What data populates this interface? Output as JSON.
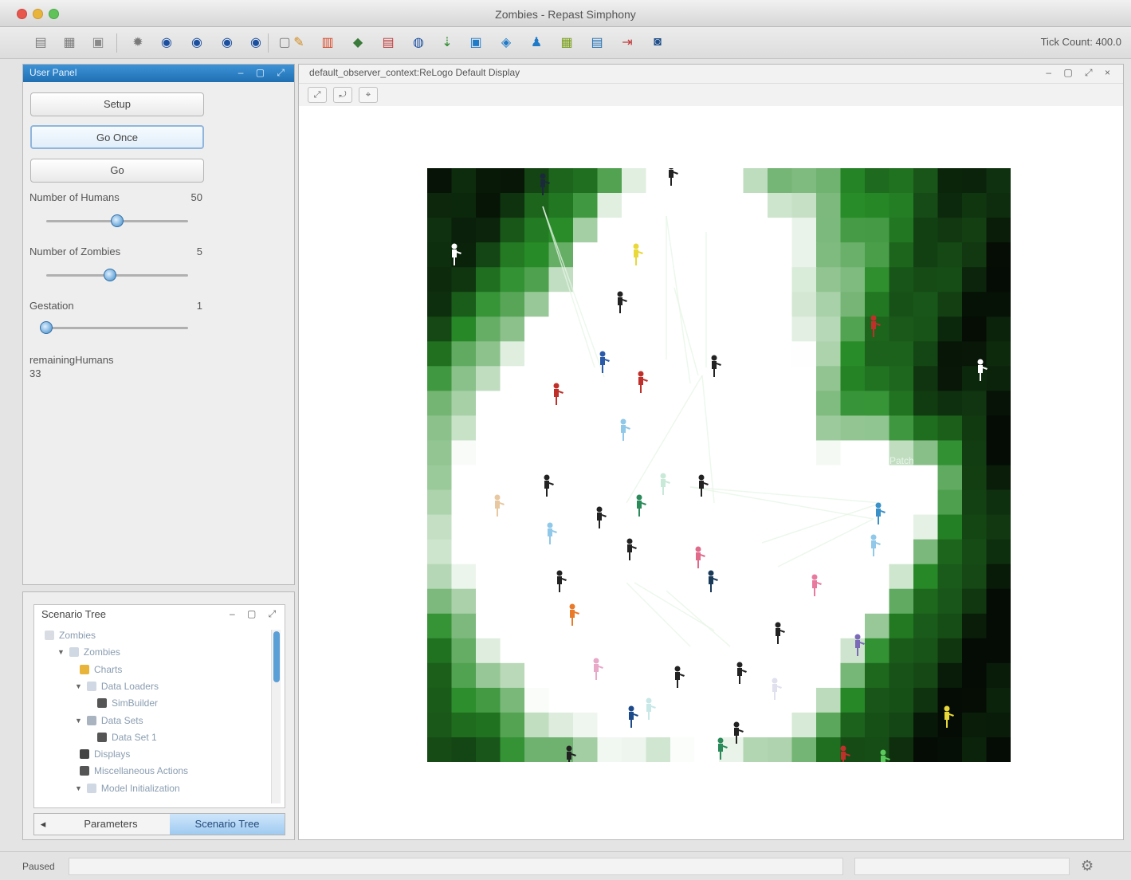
{
  "window": {
    "title": "Zombies - Repast Simphony"
  },
  "toolbar": {
    "tick_count": "Tick Count: 400.0",
    "buttons": [
      {
        "icon": "save-icon",
        "glyph": "▤",
        "color": "#7a7a7a"
      },
      {
        "icon": "floppy-icon",
        "glyph": "▦",
        "color": "#7a7a7a"
      },
      {
        "icon": "print-icon",
        "glyph": "▣",
        "color": "#8a8a8a"
      },
      {
        "icon": "settings-icon",
        "glyph": "✹",
        "color": "#7a7a7a"
      },
      {
        "icon": "step-icon",
        "glyph": "◉",
        "color": "#1b4fa0"
      },
      {
        "icon": "play-icon",
        "glyph": "◉",
        "color": "#1b4fa0"
      },
      {
        "icon": "stop-icon",
        "glyph": "◉",
        "color": "#1b4fa0"
      },
      {
        "icon": "reset-icon",
        "glyph": "◉",
        "color": "#1b4fa0"
      },
      {
        "icon": "window-icon",
        "glyph": "▢",
        "color": "#7a7a7a"
      },
      {
        "icon": "wand-icon",
        "glyph": "✎",
        "color": "#d08a1a"
      },
      {
        "icon": "chart-icon",
        "glyph": "▥",
        "color": "#d84a2a"
      },
      {
        "icon": "cube-icon",
        "glyph": "◆",
        "color": "#3a7a3a"
      },
      {
        "icon": "database-icon",
        "glyph": "▤",
        "color": "#c03a3a"
      },
      {
        "icon": "globe-icon",
        "glyph": "◍",
        "color": "#1b4fa0"
      },
      {
        "icon": "arrow-icon",
        "glyph": "⇣",
        "color": "#2a8a2a"
      },
      {
        "icon": "monitor-icon",
        "glyph": "▣",
        "color": "#1f7ac8"
      },
      {
        "icon": "network-icon",
        "glyph": "◈",
        "color": "#1f7ac8"
      },
      {
        "icon": "people-icon",
        "glyph": "♟",
        "color": "#1f7ac8"
      },
      {
        "icon": "spreadsheet-icon",
        "glyph": "▦",
        "color": "#7aa01a"
      },
      {
        "icon": "document-icon",
        "glyph": "▤",
        "color": "#1f6fb3"
      },
      {
        "icon": "export-icon",
        "glyph": "⇥",
        "color": "#c03a3a"
      },
      {
        "icon": "camera-icon",
        "glyph": "◙",
        "color": "#1f4f8a"
      }
    ]
  },
  "user_panel": {
    "title": "User Panel",
    "setup_label": "Setup",
    "go_once_label": "Go Once",
    "go_label": "Go",
    "params": [
      {
        "label": "Number of Humans",
        "value": "50",
        "level": 0.5
      },
      {
        "label": "Number of Zombies",
        "value": "5",
        "level": 0.45
      },
      {
        "label": "Gestation",
        "value": "1",
        "level": 0.0
      }
    ],
    "remaining_label": "remainingHumans",
    "remaining_value": "33"
  },
  "scenario": {
    "title": "Scenario Tree",
    "items": [
      {
        "label": "Zombies",
        "indent": 0,
        "tri": "",
        "color": "#d9dde3"
      },
      {
        "label": "Zombies",
        "indent": 1,
        "tri": "▼",
        "color": "#cfd8e3"
      },
      {
        "label": "Charts",
        "indent": 2,
        "tri": "",
        "color": "#e8b53a"
      },
      {
        "label": "Data Loaders",
        "indent": 2,
        "tri": "▼",
        "color": "#cfd8e3"
      },
      {
        "label": "SimBuilder",
        "indent": 3,
        "tri": "",
        "color": "#555555"
      },
      {
        "label": "Data Sets",
        "indent": 2,
        "tri": "▼",
        "color": "#a9b4c0"
      },
      {
        "label": "Data Set 1",
        "indent": 3,
        "tri": "",
        "color": "#555555"
      },
      {
        "label": "Displays",
        "indent": 2,
        "tri": "",
        "color": "#444444"
      },
      {
        "label": "Miscellaneous Actions",
        "indent": 2,
        "tri": "",
        "color": "#555555"
      },
      {
        "label": "Model Initialization",
        "indent": 2,
        "tri": "▼",
        "color": "#cfd8e3"
      }
    ],
    "tabs": [
      "Parameters",
      "Scenario Tree"
    ]
  },
  "display": {
    "title": "default_observer_context:ReLogo Default Display",
    "tools": [
      "⤢",
      "⤾",
      "⌖"
    ],
    "patch_label": "Patch",
    "colors": {
      "dark": "#050a05",
      "mid": "#2f8a2f",
      "light": "#ffffff"
    }
  },
  "status": {
    "text": "Paused"
  }
}
